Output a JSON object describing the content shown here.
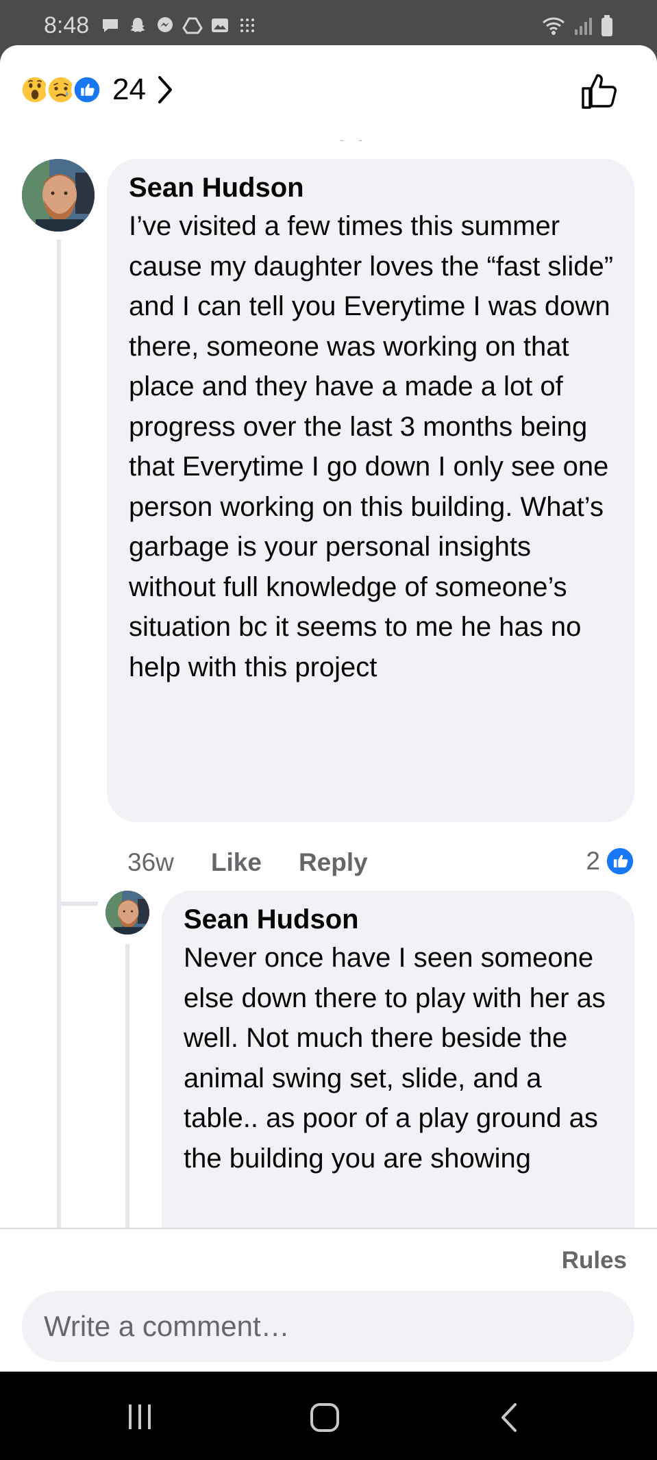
{
  "status_bar": {
    "time": "8:48",
    "icons": [
      "chat-bubble-icon",
      "snapchat-icon",
      "messenger-icon",
      "drive-icon",
      "gallery-icon",
      "grid-icon"
    ],
    "right_icons": [
      "wifi-icon",
      "signal-icon",
      "battery-icon"
    ]
  },
  "header": {
    "reactions": [
      "wow",
      "sad",
      "like"
    ],
    "reaction_count": "24",
    "colors": {
      "like": "#1877f2",
      "emoji": "#fcc53b"
    }
  },
  "comments": [
    {
      "author": "Sean Hudson",
      "text": "I’ve visited a few times this summer cause my daughter loves the “fast slide” and I can tell you Everytime I was down there, someone was working on that place and they have a made a lot of progress over the last 3 months being that Everytime I go down I only see one person working on this building. What’s garbage is your personal insights without full knowledge of someone’s situation bc it seems to me he has no help with this project",
      "time": "36w",
      "like_label": "Like",
      "reply_label": "Reply",
      "like_count": "2"
    },
    {
      "author": "Sean Hudson",
      "text": "Never once have I seen someone else down there to play with her as well. Not much there beside the animal swing set, slide, and a table.. as poor of a play ground as the building you are showing"
    }
  ],
  "footer": {
    "rules_label": "Rules",
    "composer_placeholder": "Write a comment…"
  },
  "navbar": {
    "buttons": [
      "recent-apps",
      "home",
      "back"
    ]
  },
  "colors": {
    "bubble": "#f0f2f5",
    "text": "#050505",
    "secondary": "#65676b",
    "accent": "#1877f2"
  }
}
